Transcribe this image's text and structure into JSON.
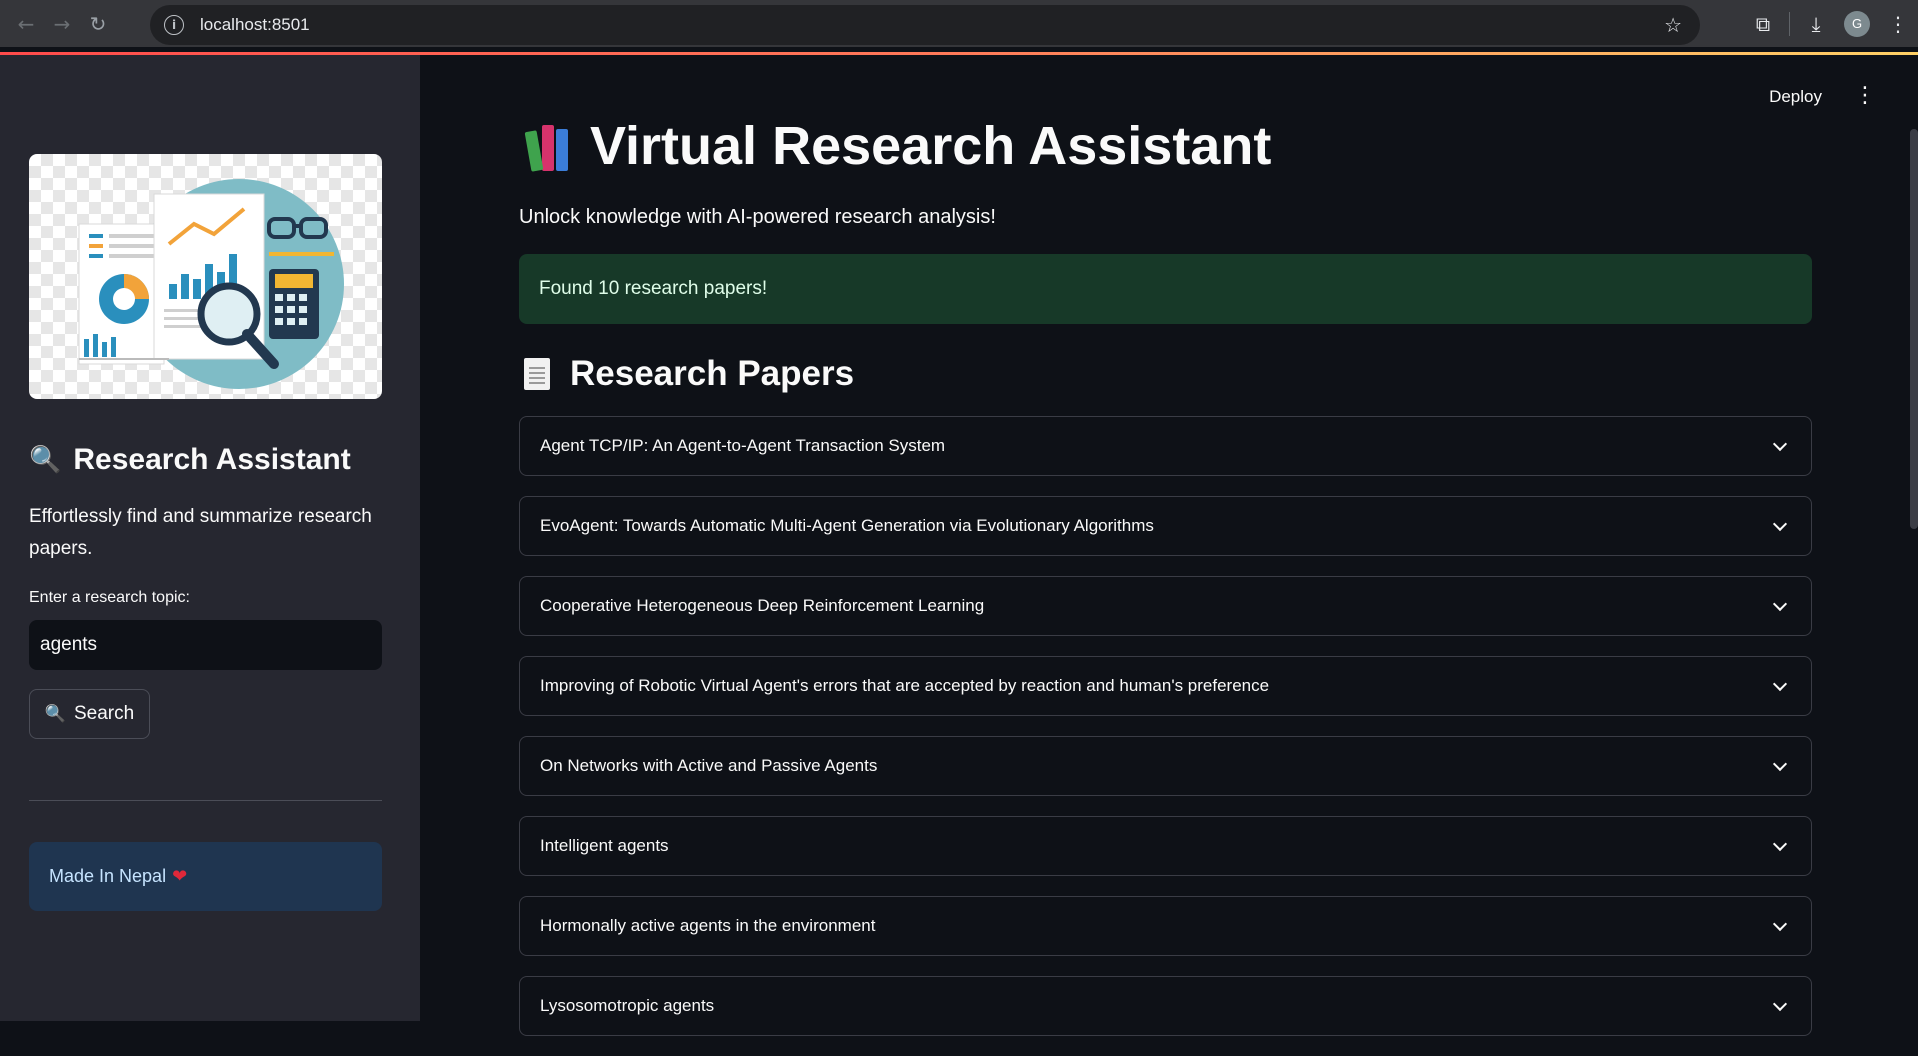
{
  "browser": {
    "url": "localhost:8501",
    "profile_initial": "G",
    "icons": [
      "back-arrow-icon",
      "forward-arrow-icon",
      "reload-icon",
      "site-info-icon",
      "bookmark-star-icon",
      "extensions-icon",
      "download-icon",
      "more-icon"
    ]
  },
  "sidebar": {
    "title": "Research Assistant",
    "description": "Effortlessly find and summarize research papers.",
    "input_label": "Enter a research topic:",
    "input_value": "agents",
    "search_button": "Search",
    "badge": "Made In Nepal"
  },
  "header": {
    "deploy_label": "Deploy"
  },
  "main": {
    "title": "Virtual Research Assistant",
    "subtitle": "Unlock knowledge with AI-powered research analysis!",
    "alert": "Found 10 research papers!",
    "section_title": "Research Papers",
    "papers": [
      "Agent TCP/IP: An Agent-to-Agent Transaction System",
      "EvoAgent: Towards Automatic Multi-Agent Generation via Evolutionary Algorithms",
      "Cooperative Heterogeneous Deep Reinforcement Learning",
      "Improving of Robotic Virtual Agent's errors that are accepted by reaction and human's preference",
      "On Networks with Active and Passive Agents",
      "Intelligent agents",
      "Hormonally active agents in the environment",
      "Lysosomotropic agents"
    ]
  },
  "colors": {
    "app_bg": "#0e1117",
    "sidebar_bg": "#262730",
    "success_bg": "#173928",
    "info_bg": "#1f3550"
  }
}
